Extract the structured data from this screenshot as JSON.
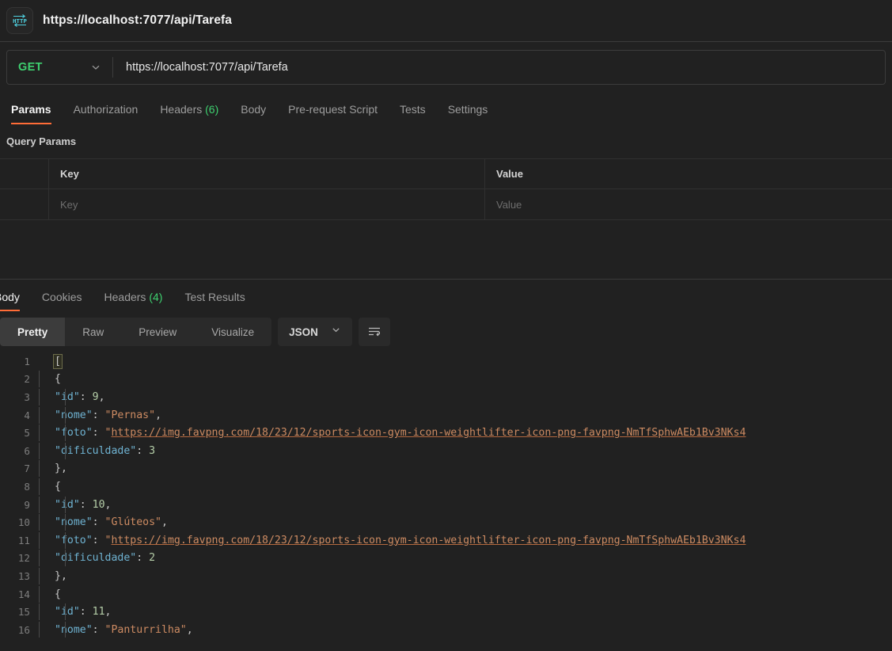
{
  "header": {
    "icon": "http-icon",
    "title": "https://localhost:7077/api/Tarefa"
  },
  "request": {
    "method": "GET",
    "url": "https://localhost:7077/api/Tarefa",
    "tabs": [
      {
        "label": "Params",
        "count": "",
        "active": true
      },
      {
        "label": "Authorization",
        "count": "",
        "active": false
      },
      {
        "label": "Headers",
        "count": "(6)",
        "active": false
      },
      {
        "label": "Body",
        "count": "",
        "active": false
      },
      {
        "label": "Pre-request Script",
        "count": "",
        "active": false
      },
      {
        "label": "Tests",
        "count": "",
        "active": false
      },
      {
        "label": "Settings",
        "count": "",
        "active": false
      }
    ],
    "query_params": {
      "section_title": "Query Params",
      "columns": [
        "Key",
        "Value"
      ],
      "empty_row": {
        "key_placeholder": "Key",
        "value_placeholder": "Value"
      }
    }
  },
  "response": {
    "tabs": [
      {
        "label": "Body",
        "count": "",
        "active": true
      },
      {
        "label": "Cookies",
        "count": "",
        "active": false
      },
      {
        "label": "Headers",
        "count": "(4)",
        "active": false
      },
      {
        "label": "Test Results",
        "count": "",
        "active": false
      }
    ],
    "view_modes": [
      {
        "label": "Pretty",
        "active": true
      },
      {
        "label": "Raw",
        "active": false
      },
      {
        "label": "Preview",
        "active": false
      },
      {
        "label": "Visualize",
        "active": false
      }
    ],
    "format": "JSON",
    "wrap_icon": "word-wrap-icon",
    "body": {
      "language": "json",
      "line_numbers": [
        1,
        2,
        3,
        4,
        5,
        6,
        7,
        8,
        9,
        10,
        11,
        12,
        13,
        14,
        15,
        16
      ],
      "json_values": {
        "items": [
          {
            "id": 9,
            "nome": "Pernas",
            "foto": "https://img.favpng.com/18/23/12/sports-icon-gym-icon-weightlifter-icon-png-favpng-NmTfSphwAEb1Bv3NKs4",
            "dificuldade": 3
          },
          {
            "id": 10,
            "nome": "Glúteos",
            "foto": "https://img.favpng.com/18/23/12/sports-icon-gym-icon-weightlifter-icon-png-favpng-NmTfSphwAEb1Bv3NKs4",
            "dificuldade": 2
          },
          {
            "id": 11,
            "nome": "Panturrilha"
          }
        ]
      },
      "lines": [
        {
          "n": "1",
          "indent": 0,
          "tokens": [
            {
              "t": "[",
              "c": "bracket-hl"
            }
          ]
        },
        {
          "n": "2",
          "indent": 1,
          "tokens": [
            {
              "t": "{",
              "c": "p"
            }
          ]
        },
        {
          "n": "3",
          "indent": 2,
          "tokens": [
            {
              "t": "\"id\"",
              "c": "k"
            },
            {
              "t": ": ",
              "c": "p"
            },
            {
              "t": "9",
              "c": "n"
            },
            {
              "t": ",",
              "c": "p"
            }
          ]
        },
        {
          "n": "4",
          "indent": 2,
          "tokens": [
            {
              "t": "\"nome\"",
              "c": "k"
            },
            {
              "t": ": ",
              "c": "p"
            },
            {
              "t": "\"Pernas\"",
              "c": "s"
            },
            {
              "t": ",",
              "c": "p"
            }
          ]
        },
        {
          "n": "5",
          "indent": 2,
          "tokens": [
            {
              "t": "\"foto\"",
              "c": "k"
            },
            {
              "t": ": ",
              "c": "p"
            },
            {
              "t": "\"",
              "c": "s"
            },
            {
              "t": "https://img.favpng.com/18/23/12/sports-icon-gym-icon-weightlifter-icon-png-favpng-NmTfSphwAEb1Bv3NKs4",
              "c": "link"
            }
          ]
        },
        {
          "n": "6",
          "indent": 2,
          "tokens": [
            {
              "t": "\"dificuldade\"",
              "c": "k"
            },
            {
              "t": ": ",
              "c": "p"
            },
            {
              "t": "3",
              "c": "n"
            }
          ]
        },
        {
          "n": "7",
          "indent": 1,
          "tokens": [
            {
              "t": "},",
              "c": "p"
            }
          ]
        },
        {
          "n": "8",
          "indent": 1,
          "tokens": [
            {
              "t": "{",
              "c": "p"
            }
          ]
        },
        {
          "n": "9",
          "indent": 2,
          "tokens": [
            {
              "t": "\"id\"",
              "c": "k"
            },
            {
              "t": ": ",
              "c": "p"
            },
            {
              "t": "10",
              "c": "n"
            },
            {
              "t": ",",
              "c": "p"
            }
          ]
        },
        {
          "n": "10",
          "indent": 2,
          "tokens": [
            {
              "t": "\"nome\"",
              "c": "k"
            },
            {
              "t": ": ",
              "c": "p"
            },
            {
              "t": "\"Glúteos\"",
              "c": "s"
            },
            {
              "t": ",",
              "c": "p"
            }
          ]
        },
        {
          "n": "11",
          "indent": 2,
          "tokens": [
            {
              "t": "\"foto\"",
              "c": "k"
            },
            {
              "t": ": ",
              "c": "p"
            },
            {
              "t": "\"",
              "c": "s"
            },
            {
              "t": "https://img.favpng.com/18/23/12/sports-icon-gym-icon-weightlifter-icon-png-favpng-NmTfSphwAEb1Bv3NKs4",
              "c": "link"
            }
          ]
        },
        {
          "n": "12",
          "indent": 2,
          "tokens": [
            {
              "t": "\"dificuldade\"",
              "c": "k"
            },
            {
              "t": ": ",
              "c": "p"
            },
            {
              "t": "2",
              "c": "n"
            }
          ]
        },
        {
          "n": "13",
          "indent": 1,
          "tokens": [
            {
              "t": "},",
              "c": "p"
            }
          ]
        },
        {
          "n": "14",
          "indent": 1,
          "tokens": [
            {
              "t": "{",
              "c": "p"
            }
          ]
        },
        {
          "n": "15",
          "indent": 2,
          "tokens": [
            {
              "t": "\"id\"",
              "c": "k"
            },
            {
              "t": ": ",
              "c": "p"
            },
            {
              "t": "11",
              "c": "n"
            },
            {
              "t": ",",
              "c": "p"
            }
          ]
        },
        {
          "n": "16",
          "indent": 2,
          "tokens": [
            {
              "t": "\"nome\"",
              "c": "k"
            },
            {
              "t": ": ",
              "c": "p"
            },
            {
              "t": "\"Panturrilha\"",
              "c": "s"
            },
            {
              "t": ",",
              "c": "p"
            }
          ]
        }
      ]
    }
  },
  "colors": {
    "accent": "#ff6c37",
    "method_get": "#3ecf6f",
    "background": "#212121",
    "json_key": "#6fb3d2",
    "json_string": "#cd8b62",
    "json_number": "#b5cea8"
  }
}
